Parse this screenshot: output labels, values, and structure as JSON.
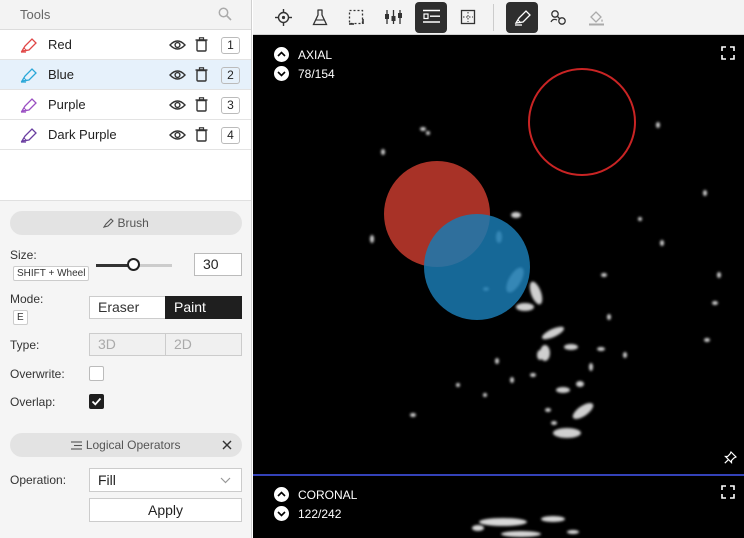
{
  "tools": {
    "title": "Tools",
    "segments": [
      {
        "name": "Red",
        "index": "1",
        "color": "#e04646"
      },
      {
        "name": "Blue",
        "index": "2",
        "color": "#2aa7d8"
      },
      {
        "name": "Purple",
        "index": "3",
        "color": "#9a4fc2"
      },
      {
        "name": "Dark Purple",
        "index": "4",
        "color": "#6a3ea0"
      }
    ]
  },
  "brush": {
    "header": "Brush",
    "size_label": "Size:",
    "size_shortcut": "SHIFT + Wheel",
    "size_value": "30",
    "mode_label": "Mode:",
    "mode_shortcut": "E",
    "mode_options": [
      "Eraser",
      "Paint"
    ],
    "mode_selected": "Paint",
    "type_label": "Type:",
    "type_options": [
      "3D",
      "2D"
    ],
    "overwrite_label": "Overwrite:",
    "overwrite_checked": false,
    "overlap_label": "Overlap:",
    "overlap_checked": true
  },
  "logical": {
    "header": "Logical Operators",
    "operation_label": "Operation:",
    "operation_value": "Fill",
    "apply_label": "Apply"
  },
  "viewports": {
    "axial": {
      "name": "AXIAL",
      "slice": "78/154"
    },
    "coronal": {
      "name": "CORONAL",
      "slice": "122/242"
    }
  },
  "toolbar_icons": [
    "crosshair-icon",
    "flask-icon",
    "selection-icon",
    "sliders-icon",
    "list-icon",
    "grid-icon",
    "brush-icon",
    "connect-icon",
    "fill-icon"
  ]
}
